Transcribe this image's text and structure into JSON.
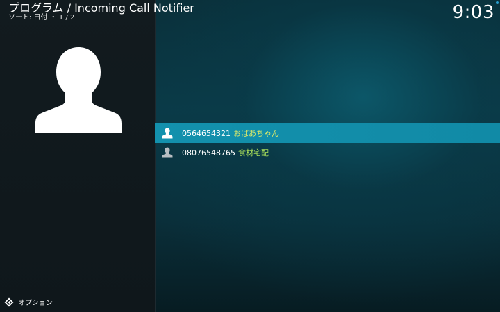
{
  "header": {
    "title": "プログラム / Incoming Call Notifier",
    "sort_label": "ソート: 日付 ・ 1 / 2"
  },
  "clock": {
    "time": "9:03"
  },
  "contacts": [
    {
      "number": "0564654321",
      "name": "おばあちゃん",
      "selected": true
    },
    {
      "number": "08076548765",
      "name": "食材宅配",
      "selected": false
    }
  ],
  "footer": {
    "options_label": "オプション"
  },
  "colors": {
    "selection": "#1391ad",
    "name_text": "#d9e86a",
    "accent_dot": "#2a9fd0"
  },
  "icons": {
    "contact": "person-silhouette-icon",
    "options": "options-diamond-icon"
  }
}
